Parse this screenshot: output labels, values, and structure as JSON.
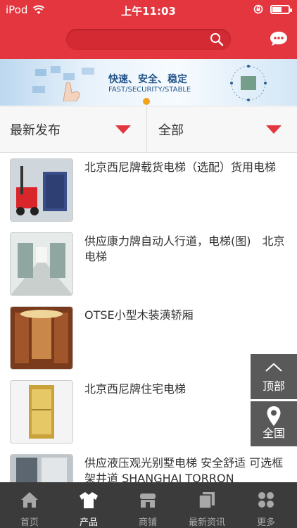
{
  "status": {
    "carrier": "iPod",
    "time": "上午11:03"
  },
  "header": {
    "search_placeholder": ""
  },
  "banner": {
    "headline": "快速、安全、稳定",
    "subline": "FAST/SECURITY/STABLE"
  },
  "filters": {
    "sort_label": "最新发布",
    "category_label": "全部"
  },
  "products": [
    {
      "title": "北京西尼牌载货电梯（选配）货用电梯"
    },
    {
      "title": "供应康力牌自动人行道，电梯(图)　北京电梯"
    },
    {
      "title": "OTSE小型木装潢轿厢"
    },
    {
      "title": "北京西尼牌住宅电梯"
    },
    {
      "title": "供应液压观光别墅电梯 安全舒适 可选框架井道 SHANGHAI TORRON"
    }
  ],
  "floating": {
    "top_label": "顶部",
    "global_label": "全国"
  },
  "tabbar": {
    "items": [
      {
        "label": "首页",
        "icon": "home-icon",
        "active": false
      },
      {
        "label": "产品",
        "icon": "shirt-icon",
        "active": true
      },
      {
        "label": "商铺",
        "icon": "store-icon",
        "active": false
      },
      {
        "label": "最新资讯",
        "icon": "news-icon",
        "active": false
      },
      {
        "label": "更多",
        "icon": "more-icon",
        "active": false
      }
    ]
  },
  "colors": {
    "accent": "#e3363f",
    "dot": "#f2a31b",
    "tabbar_bg": "#3b3b3b"
  }
}
